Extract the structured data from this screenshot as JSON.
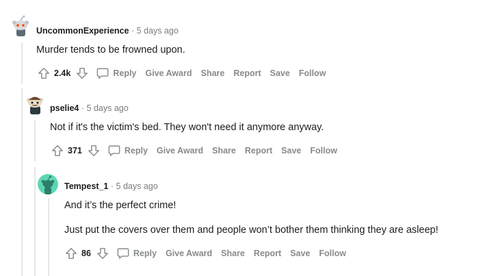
{
  "colors": {
    "muted": "#878a8c",
    "thread_line": "#e6e6e6",
    "text": "#1c1c1c"
  },
  "icons": {
    "upvote": "upvote-arrow-icon",
    "downvote": "downvote-arrow-icon",
    "reply": "speech-bubble-icon"
  },
  "comments": [
    {
      "author": "UncommonExperience",
      "separator": "·",
      "time": "5 days ago",
      "body": [
        "Murder tends to be frowned upon."
      ],
      "score": "2.4k",
      "actions": {
        "reply": "Reply",
        "give_award": "Give Award",
        "share": "Share",
        "report": "Report",
        "save": "Save",
        "follow": "Follow"
      }
    },
    {
      "author": "pselie4",
      "separator": "·",
      "time": "5 days ago",
      "body": [
        "Not if it's the victim's bed. They won't need it anymore anyway."
      ],
      "score": "371",
      "actions": {
        "reply": "Reply",
        "give_award": "Give Award",
        "share": "Share",
        "report": "Report",
        "save": "Save",
        "follow": "Follow"
      }
    },
    {
      "author": "Tempest_1",
      "separator": "·",
      "time": "5 days ago",
      "body": [
        "And it’s the perfect crime!",
        "Just put the covers over them and people won’t bother them thinking they are asleep!"
      ],
      "score": "86",
      "actions": {
        "reply": "Reply",
        "give_award": "Give Award",
        "share": "Share",
        "report": "Report",
        "save": "Save",
        "follow": "Follow"
      }
    }
  ]
}
